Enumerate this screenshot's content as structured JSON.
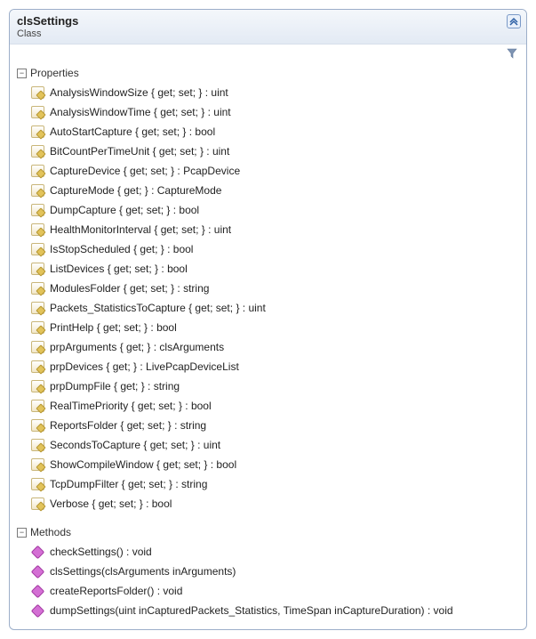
{
  "header": {
    "title": "clsSettings",
    "subtitle": "Class"
  },
  "sections": {
    "properties": {
      "title": "Properties",
      "items": [
        "AnalysisWindowSize { get; set; } : uint",
        "AnalysisWindowTime { get; set; } : uint",
        "AutoStartCapture { get; set; } : bool",
        "BitCountPerTimeUnit { get; set; } : uint",
        "CaptureDevice { get; set; } : PcapDevice",
        "CaptureMode { get; } : CaptureMode",
        "DumpCapture { get; set; } : bool",
        "HealthMonitorInterval { get; set; } : uint",
        "IsStopScheduled { get; } : bool",
        "ListDevices { get; set; } : bool",
        "ModulesFolder { get; set; } : string",
        "Packets_StatisticsToCapture { get; set; } : uint",
        "PrintHelp { get; set; } : bool",
        "prpArguments { get; } : clsArguments",
        "prpDevices { get; } : LivePcapDeviceList",
        "prpDumpFile { get; } : string",
        "RealTimePriority { get; set; } : bool",
        "ReportsFolder { get; set; } : string",
        "SecondsToCapture { get; set; } : uint",
        "ShowCompileWindow { get; set; } : bool",
        "TcpDumpFilter { get; set; } : string",
        "Verbose { get; set; } : bool"
      ]
    },
    "methods": {
      "title": "Methods",
      "items": [
        "checkSettings() : void",
        "clsSettings(clsArguments inArguments)",
        "createReportsFolder() : void",
        "dumpSettings(uint inCapturedPackets_Statistics, TimeSpan inCaptureDuration) : void"
      ]
    }
  }
}
